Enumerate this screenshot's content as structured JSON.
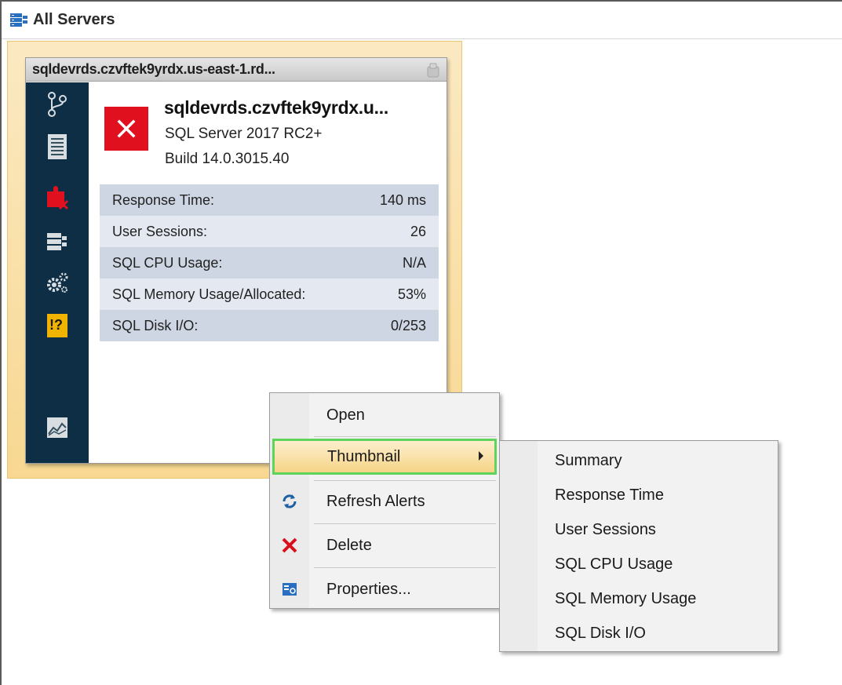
{
  "header": {
    "title": "All Servers",
    "icon": "servers-icon"
  },
  "card": {
    "title": "sqldevrds.czvftek9yrdx.us-east-1.rd...",
    "server_name": "sqldevrds.czvftek9yrdx.u...",
    "version": "SQL Server 2017 RC2+",
    "build": "Build 14.0.3015.40",
    "status": "error",
    "status_color": "#e0101e",
    "sidebar_color": "#0d2e44",
    "metrics": [
      {
        "label": "Response Time:",
        "value": "140 ms"
      },
      {
        "label": "User Sessions:",
        "value": "26"
      },
      {
        "label": "SQL CPU Usage:",
        "value": "N/A"
      },
      {
        "label": "SQL Memory Usage/Allocated:",
        "value": "53%"
      },
      {
        "label": "SQL Disk I/O:",
        "value": "0/253"
      }
    ]
  },
  "context_menu": {
    "items": [
      {
        "label": "Open",
        "icon": ""
      },
      {
        "label": "Thumbnail",
        "icon": "",
        "submenu": true,
        "active": true
      },
      {
        "label": "Refresh Alerts",
        "icon": "refresh-icon"
      },
      {
        "label": "Delete",
        "icon": "delete-icon"
      },
      {
        "label": "Properties...",
        "icon": "properties-icon"
      }
    ]
  },
  "submenu": {
    "items": [
      {
        "label": "Summary"
      },
      {
        "label": "Response Time"
      },
      {
        "label": "User Sessions"
      },
      {
        "label": "SQL CPU Usage"
      },
      {
        "label": "SQL Memory Usage"
      },
      {
        "label": "SQL Disk I/O"
      }
    ]
  },
  "colors": {
    "highlight_border": "#5fd45a",
    "card_highlight": "#f8d891"
  }
}
